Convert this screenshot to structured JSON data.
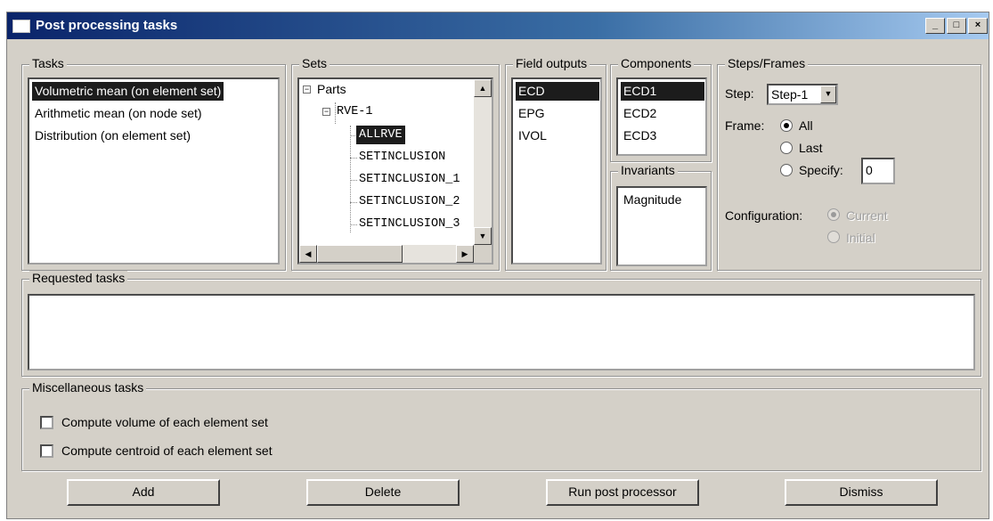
{
  "window": {
    "title": "Post processing tasks",
    "minimize_glyph": "_",
    "maximize_glyph": "□",
    "close_glyph": "×"
  },
  "tasks": {
    "label": "Tasks",
    "items": [
      {
        "label": "Volumetric mean (on element set)",
        "selected": true
      },
      {
        "label": "Arithmetic mean (on node set)",
        "selected": false
      },
      {
        "label": "Distribution (on element set)",
        "selected": false
      }
    ]
  },
  "sets": {
    "label": "Sets",
    "expander_glyph": "−",
    "root": "Parts",
    "child": "RVE-1",
    "items": [
      {
        "label": "ALLRVE",
        "selected": true
      },
      {
        "label": "SETINCLUSION",
        "selected": false
      },
      {
        "label": "SETINCLUSION_1",
        "selected": false
      },
      {
        "label": "SETINCLUSION_2",
        "selected": false
      },
      {
        "label": "SETINCLUSION_3",
        "selected": false
      }
    ],
    "scroll_up_glyph": "▲",
    "scroll_down_glyph": "▼",
    "scroll_left_glyph": "◀",
    "scroll_right_glyph": "▶"
  },
  "field_outputs": {
    "label": "Field outputs",
    "items": [
      {
        "label": "ECD",
        "selected": true
      },
      {
        "label": "EPG",
        "selected": false
      },
      {
        "label": "IVOL",
        "selected": false
      }
    ]
  },
  "components": {
    "label": "Components",
    "items": [
      {
        "label": "ECD1",
        "selected": true
      },
      {
        "label": "ECD2",
        "selected": false
      },
      {
        "label": "ECD3",
        "selected": false
      }
    ]
  },
  "invariants": {
    "label": "Invariants",
    "items": [
      {
        "label": "Magnitude",
        "selected": false
      }
    ]
  },
  "steps_frames": {
    "label": "Steps/Frames",
    "step_label": "Step:",
    "step_value": "Step-1",
    "combo_glyph": "▼",
    "frame_label": "Frame:",
    "frame_options": [
      "All",
      "Last",
      "Specify:"
    ],
    "frame_selected": "All",
    "specify_value": "0",
    "configuration_label": "Configuration:",
    "configuration_options": [
      "Current",
      "Initial"
    ],
    "configuration_selected": "Current",
    "configuration_enabled": false
  },
  "requested_tasks": {
    "label": "Requested tasks"
  },
  "misc": {
    "label": "Miscellaneous tasks",
    "options": [
      {
        "label": "Compute volume of each element set",
        "checked": false
      },
      {
        "label": "Compute centroid of each element set",
        "checked": false
      }
    ]
  },
  "buttons": {
    "add": "Add",
    "delete": "Delete",
    "run": "Run post processor",
    "dismiss": "Dismiss"
  }
}
